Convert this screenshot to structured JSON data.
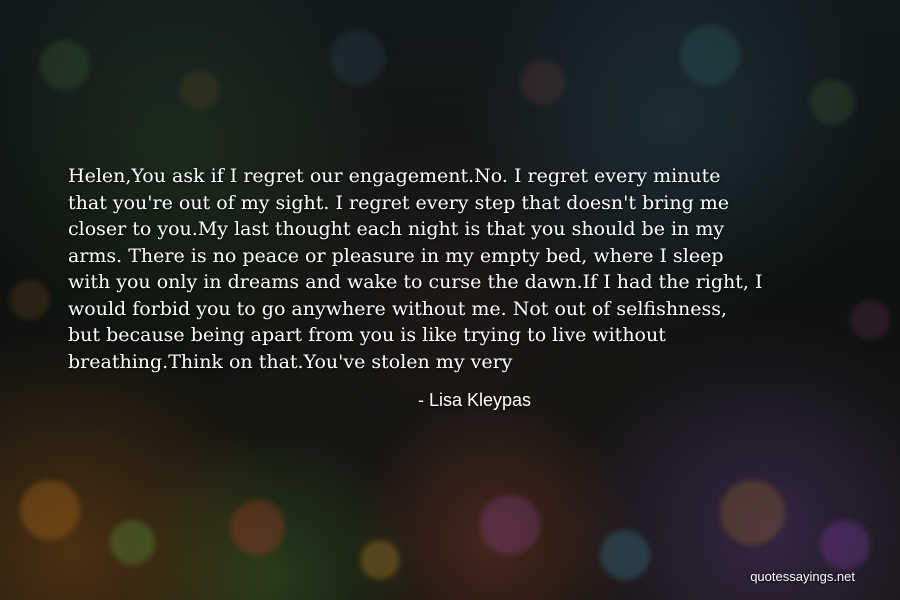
{
  "quote": {
    "text": "Helen,You ask if I regret our engagement.No. I regret every minute\nthat you're out of my sight. I regret every step that doesn't bring me\ncloser to you.My last thought each night is that you should be in my\narms. There is no peace or pleasure in my empty bed, where I sleep\nwith you only in dreams and wake to curse the dawn.If I had the right, I\nwould forbid you to go anywhere without me. Not out of selfishness,\nbut because being apart from you is like trying to live without\nbreathing.Think on that.You've stolen my very",
    "author": "- Lisa Kleypas"
  },
  "watermark": "quotessayings.net",
  "colors": {
    "text": "#ffffff",
    "background": "#0d1210"
  }
}
